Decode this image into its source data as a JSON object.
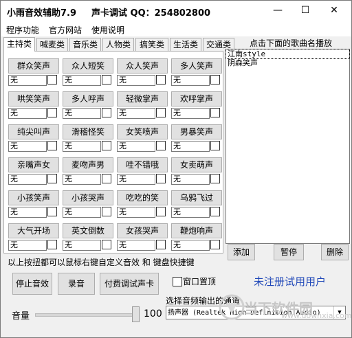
{
  "app": {
    "title": "小雨音效辅助7.9",
    "qq_label": "声卡调试 QQ：254802800"
  },
  "window_buttons": {
    "minimize": "—",
    "maximize": "☐",
    "close": "✕"
  },
  "menu": [
    "程序功能",
    "官方网站",
    "使用说明"
  ],
  "tabs": [
    "主持类",
    "喊麦类",
    "音乐类",
    "人物类",
    "搞笑类",
    "生活类",
    "交通类"
  ],
  "sound_buttons": [
    {
      "label": "群众笑声",
      "key": "无"
    },
    {
      "label": "众人短笑",
      "key": "无"
    },
    {
      "label": "众人笑声",
      "key": "无"
    },
    {
      "label": "多人笑声",
      "key": "无"
    },
    {
      "label": "哄笑笑声",
      "key": "无"
    },
    {
      "label": "多人呼声",
      "key": "无"
    },
    {
      "label": "轻微掌声",
      "key": "无"
    },
    {
      "label": "欢呼掌声",
      "key": "无"
    },
    {
      "label": "纯尖叫声",
      "key": "无"
    },
    {
      "label": "滑稽怪笑",
      "key": "无"
    },
    {
      "label": "女笑喷声",
      "key": "无"
    },
    {
      "label": "男暴笑声",
      "key": "无"
    },
    {
      "label": "亲嘴声女",
      "key": "无"
    },
    {
      "label": "麦吻声男",
      "key": "无"
    },
    {
      "label": "哇不错哦",
      "key": "无"
    },
    {
      "label": "女卖萌声",
      "key": "无"
    },
    {
      "label": "小孩笑声",
      "key": "无"
    },
    {
      "label": "小孩哭声",
      "key": "无"
    },
    {
      "label": "吃吃的笑",
      "key": "无"
    },
    {
      "label": "乌鸦飞过",
      "key": "无"
    },
    {
      "label": "大气开场",
      "key": "无"
    },
    {
      "label": "英文倒数",
      "key": "无"
    },
    {
      "label": "女孩哭声",
      "key": "无"
    },
    {
      "label": "鞭炮响声",
      "key": "无"
    }
  ],
  "playlist": {
    "header": "点击下面的歌曲名播放",
    "songs": [
      "江南style",
      "阴森笑声"
    ],
    "add": "添加",
    "pause": "暂停",
    "delete": "删除"
  },
  "hint": "以上按扭都可以鼠标右键自定义音效 和 键盘快捷键",
  "bottom": {
    "stop": "停止音效",
    "record": "录音",
    "paid": "付费调试声卡",
    "pin_label": "窗口置顶",
    "unregistered": "未注册试用用户",
    "output_label": "选择音频输出的通道",
    "output_device": "扬声器 (Realtek High Definition Audio)",
    "volume_label": "音量",
    "volume": 100
  },
  "watermark": {
    "text": "当下软件园",
    "url": "www.downxia.com"
  }
}
